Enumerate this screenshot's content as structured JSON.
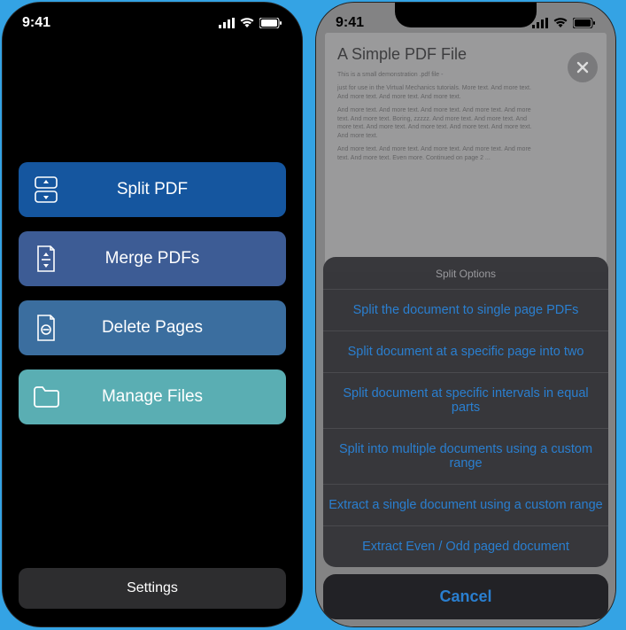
{
  "status": {
    "time": "9:41"
  },
  "left": {
    "menu": [
      {
        "label": "Split PDF",
        "color": "#15569f"
      },
      {
        "label": "Merge PDFs",
        "color": "#3d5c95"
      },
      {
        "label": "Delete Pages",
        "color": "#3b6e9f"
      },
      {
        "label": "Manage Files",
        "color": "#5aaeb3"
      }
    ],
    "settings_label": "Settings"
  },
  "right": {
    "doc_title": "A Simple PDF File",
    "sheet_title": "Split Options",
    "options": [
      "Split the document to single page PDFs",
      "Split document at a specific page into two",
      "Split document at specific intervals in equal parts",
      "Split into multiple documents using a custom range",
      "Extract a single document using a custom range",
      "Extract Even / Odd paged document"
    ],
    "cancel_label": "Cancel"
  }
}
